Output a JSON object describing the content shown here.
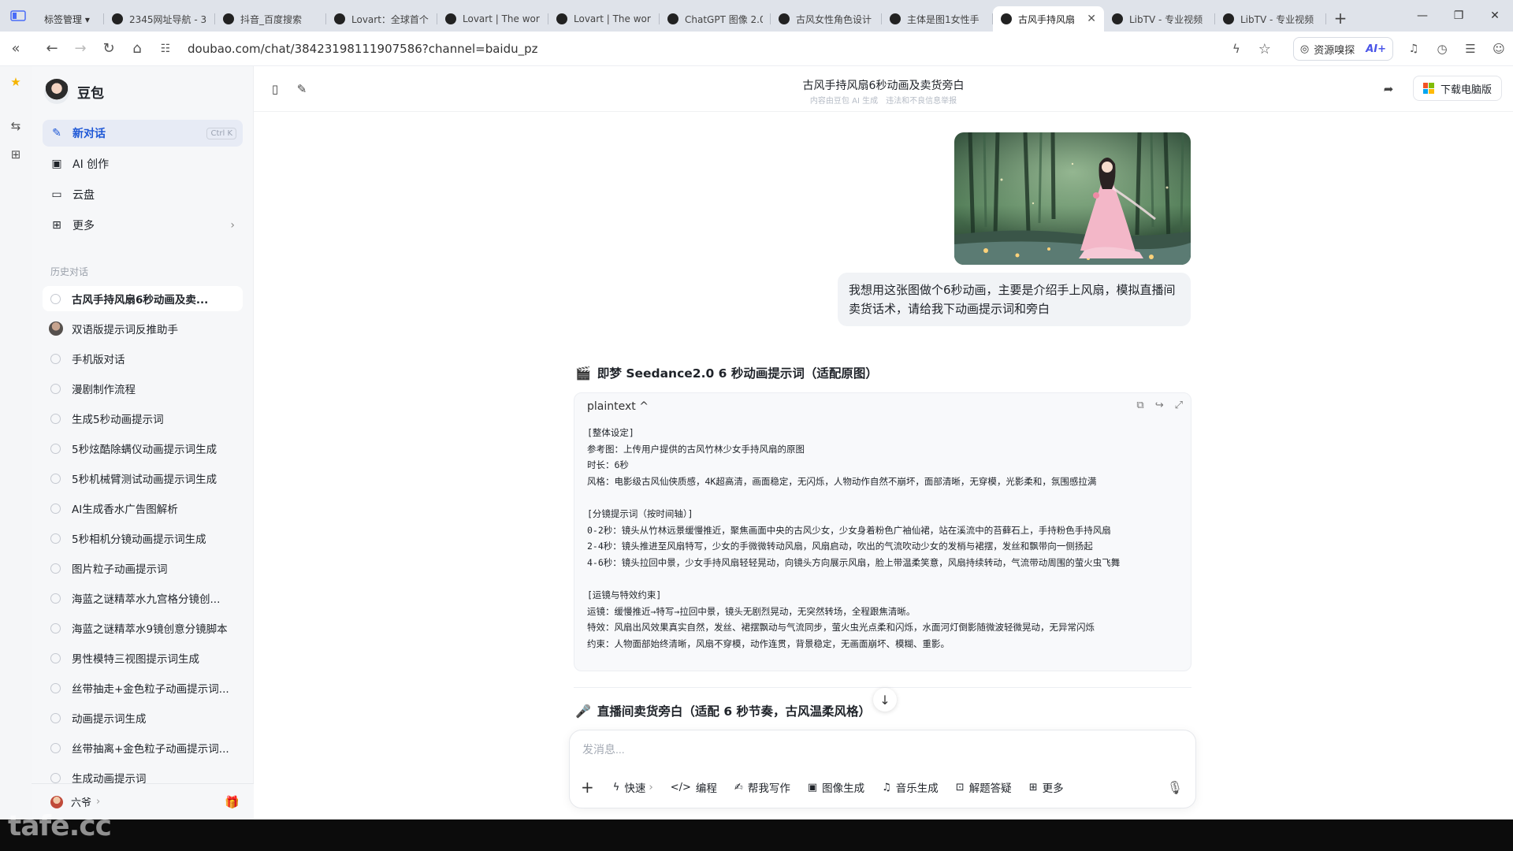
{
  "browser": {
    "tabs": [
      {
        "label": "标签管理 ▾"
      },
      {
        "label": "2345网址导航 - 3"
      },
      {
        "label": "抖音_百度搜索"
      },
      {
        "label": "Lovart：全球首个"
      },
      {
        "label": "Lovart | The wor"
      },
      {
        "label": "Lovart | The wor"
      },
      {
        "label": "ChatGPT 图像 2.0"
      },
      {
        "label": "古风女性角色设计"
      },
      {
        "label": "主体是图1女性手"
      },
      {
        "label": "古风手持风扇"
      },
      {
        "label": "LibTV - 专业视频"
      },
      {
        "label": "LibTV - 专业视频"
      }
    ],
    "active_tab_index": 9,
    "url": "doubao.com/chat/38423198111907586?channel=baidu_pz",
    "resource_sniff": "资源嗅探",
    "ai_label": "AI+"
  },
  "app": {
    "name": "豆包",
    "menu": [
      {
        "label": "新对话",
        "icon": "new-chat-icon",
        "shortcut": "Ctrl K"
      },
      {
        "label": "AI 创作",
        "icon": "image-icon"
      },
      {
        "label": "云盘",
        "icon": "folder-icon"
      },
      {
        "label": "更多",
        "icon": "grid-icon"
      }
    ],
    "history_title": "历史对话",
    "history": [
      {
        "label": "古风手持风扇6秒动画及卖...",
        "active": true
      },
      {
        "label": "双语版提示词反推助手",
        "face": true
      },
      {
        "label": "手机版对话"
      },
      {
        "label": "漫剧制作流程"
      },
      {
        "label": "生成5秒动画提示词"
      },
      {
        "label": "5秒炫酷除螨仪动画提示词生成"
      },
      {
        "label": "5秒机械臂测试动画提示词生成"
      },
      {
        "label": "AI生成香水广告图解析"
      },
      {
        "label": "5秒相机分镜动画提示词生成"
      },
      {
        "label": "图片粒子动画提示词"
      },
      {
        "label": "海蓝之谜精萃水九宫格分镜创..."
      },
      {
        "label": "海蓝之谜精萃水9镜创意分镜脚本"
      },
      {
        "label": "男性模特三视图提示词生成"
      },
      {
        "label": "丝带抽走+金色粒子动画提示词..."
      },
      {
        "label": "动画提示词生成"
      },
      {
        "label": "丝带抽离+金色粒子动画提示词..."
      },
      {
        "label": "生成动画提示词"
      }
    ],
    "user_name": "六爷"
  },
  "chat": {
    "title": "古风手持风扇6秒动画及卖货旁白",
    "subtitle": "内容由豆包 AI 生成　违法和不良信息举报",
    "download_label": "下载电脑版",
    "user_message": "我想用这张图做个6秒动画，主要是介绍手上风扇，模拟直播间卖货话术，请给我下动画提示词和旁白",
    "section1_emoji": "🎬",
    "section1_title": "即梦 Seedance2.0 6 秒动画提示词（适配原图）",
    "code_lang": "plaintext ^",
    "code_lines": [
      "[整体设定]",
      "参考图：上传用户提供的古风竹林少女手持风扇的原图",
      "时长：6秒",
      "风格：电影级古风仙侠质感，4K超高清，画面稳定，无闪烁，人物动作自然不崩坏，面部清晰，无穿模，光影柔和，氛围感拉满",
      "",
      "[分镜提示词（按时间轴）]",
      "0-2秒：镜头从竹林远景缓慢推近，聚焦画面中央的古风少女，少女身着粉色广袖仙裙，站在溪流中的苔藓石上，手持粉色手持风扇",
      "2-4秒：镜头推进至风扇特写，少女的手微微转动风扇，风扇启动，吹出的气流吹动少女的发梢与裙摆，发丝和飘带向一侧扬起",
      "4-6秒：镜头拉回中景，少女手持风扇轻轻晃动，向镜头方向展示风扇，脸上带温柔笑意，风扇持续转动，气流带动周围的萤火虫飞舞",
      "",
      "[运镜与特效约束]",
      "运镜：缓慢推近→特写→拉回中景，镜头无剧烈晃动，无突然转场，全程跟焦清晰。",
      "特效：风扇出风效果真实自然，发丝、裙摆飘动与气流同步，萤火虫光点柔和闪烁，水面河灯倒影随微波轻微晃动，无异常闪烁",
      "约束：人物面部始终清晰，风扇不穿模，动作连贯，背景稳定，无画面崩坏、模糊、重影。"
    ],
    "section2_emoji": "🎤",
    "section2_title": "直播间卖货旁白（适配 6 秒节奏，古风温柔风格）",
    "composer_placeholder": "发消息...",
    "tools": [
      {
        "label": "快速",
        "icon": "bolt-icon"
      },
      {
        "label": "编程",
        "icon": "code-icon"
      },
      {
        "label": "帮我写作",
        "icon": "write-icon"
      },
      {
        "label": "图像生成",
        "icon": "image-gen-icon"
      },
      {
        "label": "音乐生成",
        "icon": "music-icon"
      },
      {
        "label": "解题答疑",
        "icon": "solve-icon"
      },
      {
        "label": "更多",
        "icon": "grid-icon"
      }
    ]
  },
  "watermark": "tafe.cc"
}
